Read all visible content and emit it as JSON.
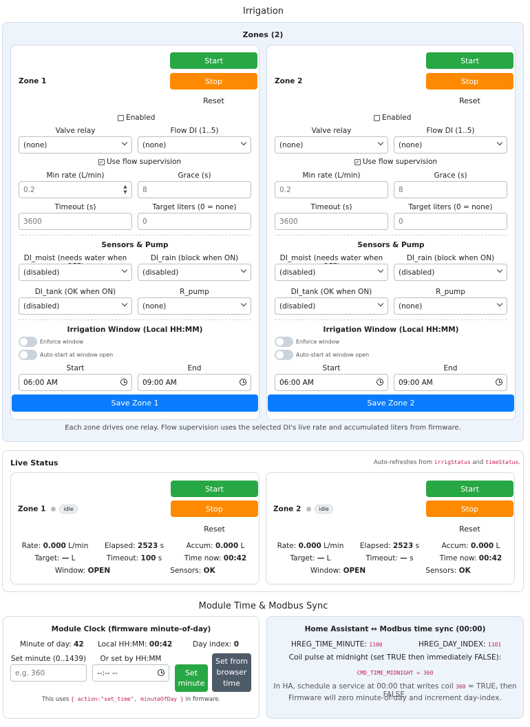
{
  "page_title": "Irrigation",
  "zones_panel": {
    "title": "Zones (2)",
    "footnote": "Each zone drives one relay. Flow supervision uses the selected DI's live rate and accumulated liters from firmware."
  },
  "zone_cards": [
    {
      "name": "Zone 1",
      "start": "Start",
      "stop": "Stop",
      "reset": "Reset",
      "enabled_label": "Enabled",
      "enabled_checked": false,
      "valve_relay_label": "Valve relay",
      "valve_relay_value": "(none)",
      "flow_di_label": "Flow DI (1..5)",
      "flow_di_value": "(none)",
      "use_flow_label": "Use flow supervision",
      "use_flow_checked": true,
      "min_rate_label": "Min rate (L/min)",
      "min_rate_value": "0.2",
      "grace_label": "Grace (s)",
      "grace_value": "8",
      "timeout_label": "Timeout (s)",
      "timeout_value": "3600",
      "target_label": "Target liters (0 = none)",
      "target_value": "0",
      "sensors_title": "Sensors & Pump",
      "di_moist_label": "DI_moist (needs water when OFF)",
      "di_moist_value": "(disabled)",
      "di_rain_label": "DI_rain (block when ON)",
      "di_rain_value": "(disabled)",
      "di_tank_label": "DI_tank (OK when ON)",
      "di_tank_value": "(disabled)",
      "r_pump_label": "R_pump",
      "r_pump_value": "(none)",
      "window_title": "Irrigation Window (Local HH:MM)",
      "enforce_label": "Enforce window",
      "autostart_label": "Auto-start at window open",
      "start_time_label": "Start",
      "start_time_value": "06:00 AM",
      "end_time_label": "End",
      "end_time_value": "09:00 AM",
      "save": "Save Zone 1"
    },
    {
      "name": "Zone 2",
      "start": "Start",
      "stop": "Stop",
      "reset": "Reset",
      "enabled_label": "Enabled",
      "enabled_checked": false,
      "valve_relay_label": "Valve relay",
      "valve_relay_value": "(none)",
      "flow_di_label": "Flow DI (1..5)",
      "flow_di_value": "(none)",
      "use_flow_label": "Use flow supervision",
      "use_flow_checked": true,
      "min_rate_label": "Min rate (L/min)",
      "min_rate_value": "0.2",
      "grace_label": "Grace (s)",
      "grace_value": "8",
      "timeout_label": "Timeout (s)",
      "timeout_value": "3600",
      "target_label": "Target liters (0 = none)",
      "target_value": "0",
      "sensors_title": "Sensors & Pump",
      "di_moist_label": "DI_moist (needs water when OFF)",
      "di_moist_value": "(disabled)",
      "di_rain_label": "DI_rain (block when ON)",
      "di_rain_value": "(disabled)",
      "di_tank_label": "DI_tank (OK when ON)",
      "di_tank_value": "(disabled)",
      "r_pump_label": "R_pump",
      "r_pump_value": "(none)",
      "window_title": "Irrigation Window (Local HH:MM)",
      "enforce_label": "Enforce window",
      "autostart_label": "Auto-start at window open",
      "start_time_label": "Start",
      "start_time_value": "06:00 AM",
      "end_time_label": "End",
      "end_time_value": "09:00 AM",
      "save": "Save Zone 2"
    }
  ],
  "live_status": {
    "title": "Live Status",
    "autorefresh_prefix": "Auto-refreshes from",
    "autorefresh_code1": "irrigStatus",
    "autorefresh_and": "and",
    "autorefresh_code2": "timeStatus",
    "autorefresh_suffix": ".",
    "zones": [
      {
        "name": "Zone 1",
        "state": "idle",
        "start": "Start",
        "stop": "Stop",
        "reset": "Reset",
        "rate_label": "Rate:",
        "rate_value": "0.000",
        "rate_unit": "L/min",
        "elapsed_label": "Elapsed:",
        "elapsed_value": "2523",
        "elapsed_unit": "s",
        "accum_label": "Accum:",
        "accum_value": "0.000",
        "accum_unit": "L",
        "target_label": "Target:",
        "target_value": "—",
        "target_unit": "L",
        "timeout_label": "Timeout:",
        "timeout_value": "100",
        "timeout_unit": "s",
        "timenow_label": "Time now:",
        "timenow_value": "00:42",
        "window_label": "Window:",
        "window_value": "OPEN",
        "sensors_label": "Sensors:",
        "sensors_value": "OK"
      },
      {
        "name": "Zone 2",
        "state": "idle",
        "start": "Start",
        "stop": "Stop",
        "reset": "Reset",
        "rate_label": "Rate:",
        "rate_value": "0.000",
        "rate_unit": "L/min",
        "elapsed_label": "Elapsed:",
        "elapsed_value": "2523",
        "elapsed_unit": "s",
        "accum_label": "Accum:",
        "accum_value": "0.000",
        "accum_unit": "L",
        "target_label": "Target:",
        "target_value": "—",
        "target_unit": "L",
        "timeout_label": "Timeout:",
        "timeout_value": "—",
        "timeout_unit": "s",
        "timenow_label": "Time now:",
        "timenow_value": "00:42",
        "window_label": "Window:",
        "window_value": "OPEN",
        "sensors_label": "Sensors:",
        "sensors_value": "OK"
      }
    ]
  },
  "module_time": {
    "title": "Module Time & Modbus Sync",
    "clock": {
      "title": "Module Clock (firmware minute-of-day)",
      "minute_label": "Minute of day:",
      "minute_value": "42",
      "local_label": "Local HH:MM:",
      "local_value": "00:42",
      "dayindex_label": "Day index:",
      "dayindex_value": "0",
      "set_minute_label": "Set minute (0..1439)",
      "set_minute_placeholder": "e.g. 360",
      "hhmm_label": "Or set by HH:MM",
      "hhmm_value": "--:-- --",
      "set_minute_btn_line1": "Set",
      "set_minute_btn_line2": "minute",
      "browser_btn_line1": "Set from",
      "browser_btn_line2": "browser",
      "browser_btn_line3": "time",
      "uses_prefix": "This uses",
      "uses_code": "{ action:\"set_time\", minuteOfDay }",
      "uses_suffix": "in firmware."
    },
    "ha": {
      "title": "Home Assistant ↔ Modbus time sync (00:00)",
      "hreg_minute_label": "HREG_TIME_MINUTE:",
      "hreg_minute_value": "1100",
      "hreg_day_label": "HREG_DAY_INDEX:",
      "hreg_day_value": "1101",
      "coil_text": "Coil pulse at midnight (set TRUE then immediately FALSE):",
      "cmd_text": "CMD_TIME_MIDNIGHT = 360",
      "schedule_prefix": "In HA, schedule a service at 00:00 that writes coil",
      "schedule_code": "360",
      "schedule_suffix": "= TRUE, then FALSE.",
      "firmware_text": "Firmware will zero minute-of-day and increment day-index."
    }
  },
  "colors": {
    "start": "#28a745",
    "stop": "#fd8a00",
    "save": "#0a7cff",
    "dark_button": "#4d5a68",
    "code": "#c2185b"
  }
}
